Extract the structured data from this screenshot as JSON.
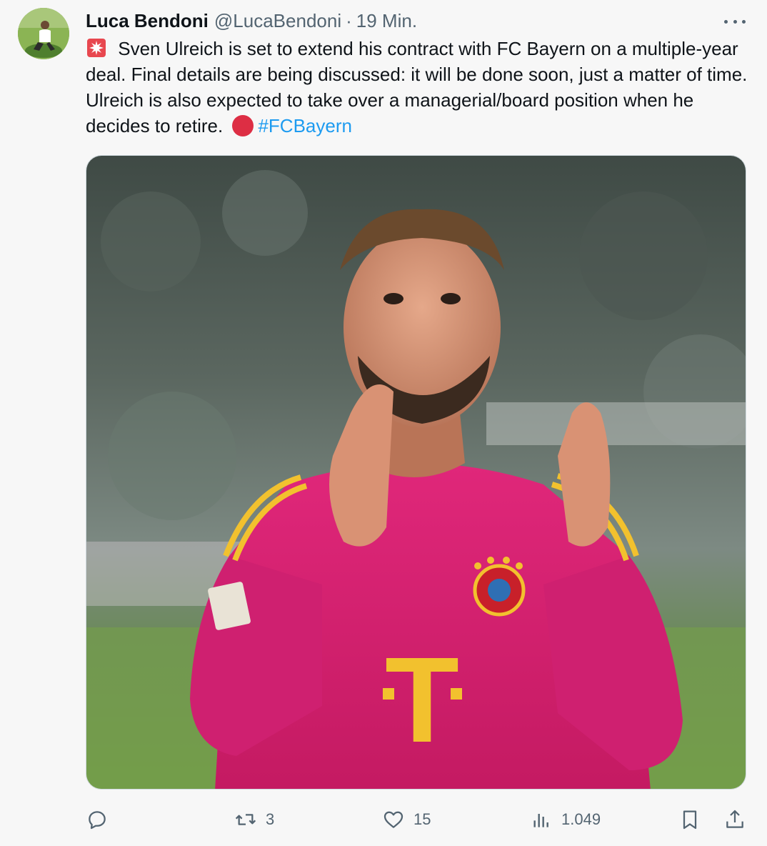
{
  "tweet": {
    "display_name": "Luca Bendoni",
    "handle": "@LucaBendoni",
    "separator": "·",
    "timestamp": "19 Min.",
    "text_main": " Sven Ulreich is set to extend his contract with FC Bayern on a multiple-year deal. Final details are being discussed: it will be done soon, just a matter of time. Ulreich is also expected to take over a managerial/board position when he decides to retire.",
    "hashtag": "#FCBayern",
    "emoji_start": "siren-emoji",
    "emoji_end": "red-circle-emoji"
  },
  "media": {
    "jersey_color": "#d6206f",
    "jersey_text": "T"
  },
  "actions": {
    "reply_count": "",
    "retweet_count": "3",
    "like_count": "15",
    "views_count": "1.049"
  },
  "colors": {
    "text": "#0f1419",
    "secondary": "#536471",
    "link": "#1d9bf0",
    "background": "#f7f7f7"
  }
}
